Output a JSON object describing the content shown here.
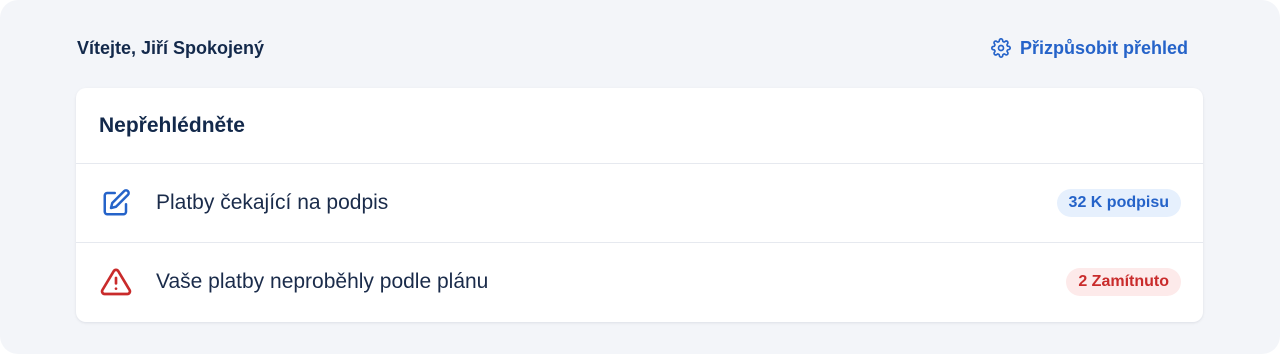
{
  "header": {
    "welcome_text": "Vítejte, Jiří Spokojený",
    "customize_label": "Přizpůsobit přehled",
    "customize_icon": "gear-icon"
  },
  "card": {
    "title": "Nepřehlédněte",
    "items": [
      {
        "icon": "edit-icon",
        "label": "Platby čekající na podpis",
        "badge": "32 K podpisu",
        "badge_color": "#2563c9"
      },
      {
        "icon": "warning-icon",
        "label": "Vaše platby neproběhly podle plánu",
        "badge": "2 Zamítnuto",
        "badge_color": "#c92b2b"
      }
    ]
  },
  "colors": {
    "accent": "#2563c9",
    "danger": "#c92b2b",
    "heading": "#13294b",
    "background": "#f3f5f9"
  }
}
